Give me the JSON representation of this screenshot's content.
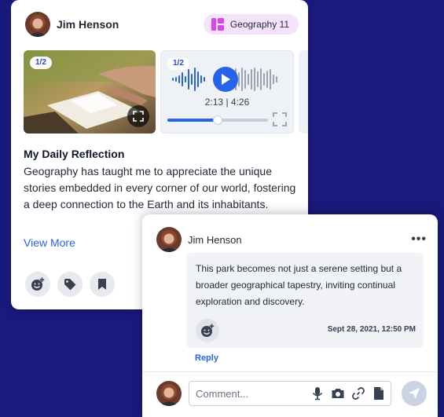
{
  "post": {
    "author": "Jim Henson",
    "subject_badge": "Geography 11",
    "media": {
      "photo_counter": "1/2",
      "audio_counter": "1/2",
      "audio_current": "2:13",
      "audio_separator": "|",
      "audio_total": "4:26",
      "audio_progress_fraction": 0.5
    },
    "title": "My Daily Reflection",
    "body": "Geography has taught me to appreciate the unique stories embedded in every corner of our world, fostering a deep connection to the Earth and its inhabitants.",
    "view_more": "View More"
  },
  "comment": {
    "author": "Jim Henson",
    "more_label": "•••",
    "text": "This park becomes not just a serene setting but a broader geographical tapestry, inviting continual exploration and discovery.",
    "timestamp": "Sept 28, 2021, 12:50 PM",
    "reply_label": "Reply"
  },
  "composer": {
    "placeholder": "Comment..."
  },
  "colors": {
    "background": "#1a1a7e",
    "accent": "#2563eb",
    "badge_bg": "#f3e3fb",
    "badge_icon": "#d946ef"
  },
  "icons": [
    "grid-icon",
    "fullscreen-icon",
    "play-icon",
    "add-emoji-icon",
    "tag-icon",
    "bookmark-icon",
    "more-icon",
    "microphone-icon",
    "camera-icon",
    "link-icon",
    "file-icon",
    "send-icon"
  ]
}
